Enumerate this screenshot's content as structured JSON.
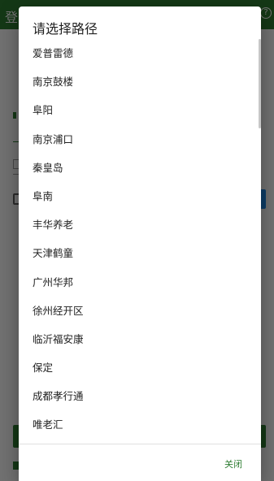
{
  "app": {
    "title": "登",
    "help_glyph": "?"
  },
  "dialog": {
    "title": "请选择路径",
    "items": [
      {
        "label": "爱普雷德"
      },
      {
        "label": "南京鼓楼"
      },
      {
        "label": "阜阳"
      },
      {
        "label": "南京浦口"
      },
      {
        "label": "秦皇岛"
      },
      {
        "label": "阜南"
      },
      {
        "label": "丰华养老"
      },
      {
        "label": "天津鹤童"
      },
      {
        "label": "广州华邦"
      },
      {
        "label": "徐州经开区"
      },
      {
        "label": "临沂福安康"
      },
      {
        "label": "保定"
      },
      {
        "label": "成都孝行通"
      },
      {
        "label": "唯老汇"
      }
    ],
    "close_label": "关闭"
  },
  "colors": {
    "accent": "#2e7d32",
    "scrim": "rgba(0,0,0,0.55)"
  }
}
